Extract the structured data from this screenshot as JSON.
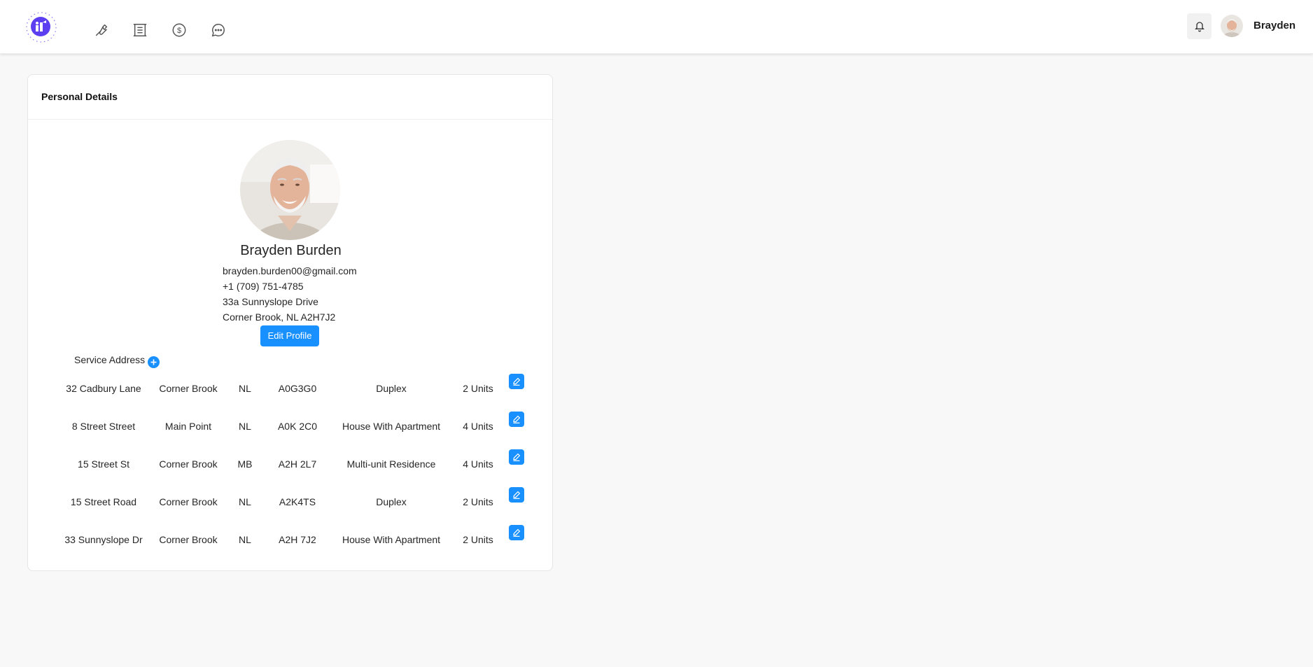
{
  "header": {
    "nav_icons": [
      "wrench-icon",
      "building-icon",
      "dollar-icon",
      "chat-icon"
    ],
    "notification_icon": "bell-icon",
    "username": "Brayden"
  },
  "card": {
    "title": "Personal Details",
    "profile": {
      "name": "Brayden Burden",
      "email": "brayden.burden00@gmail.com",
      "phone": "+1 (709) 751-4785",
      "address_line1": "33a Sunnyslope Drive",
      "address_line2": "Corner Brook, NL A2H7J2"
    },
    "edit_profile_label": "Edit Profile",
    "service_address_label": "Service Address",
    "addresses": [
      {
        "street": "32 Cadbury Lane",
        "city": "Corner Brook",
        "province": "NL",
        "postal": "A0G3G0",
        "type": "Duplex",
        "units": "2 Units"
      },
      {
        "street": "8 Street Street",
        "city": "Main Point",
        "province": "NL",
        "postal": "A0K 2C0",
        "type": "House With Apartment",
        "units": "4 Units"
      },
      {
        "street": "15 Street St",
        "city": "Corner Brook",
        "province": "MB",
        "postal": "A2H 2L7",
        "type": "Multi-unit Residence",
        "units": "4 Units"
      },
      {
        "street": "15 Street Road",
        "city": "Corner Brook",
        "province": "NL",
        "postal": "A2K4TS",
        "type": "Duplex",
        "units": "2 Units"
      },
      {
        "street": "33 Sunnyslope Dr",
        "city": "Corner Brook",
        "province": "NL",
        "postal": "A2H 7J2",
        "type": "House With Apartment",
        "units": "2 Units"
      }
    ]
  },
  "colors": {
    "accent": "#1890ff",
    "logo": "#5b3ff0",
    "background": "#f8f8f8"
  }
}
